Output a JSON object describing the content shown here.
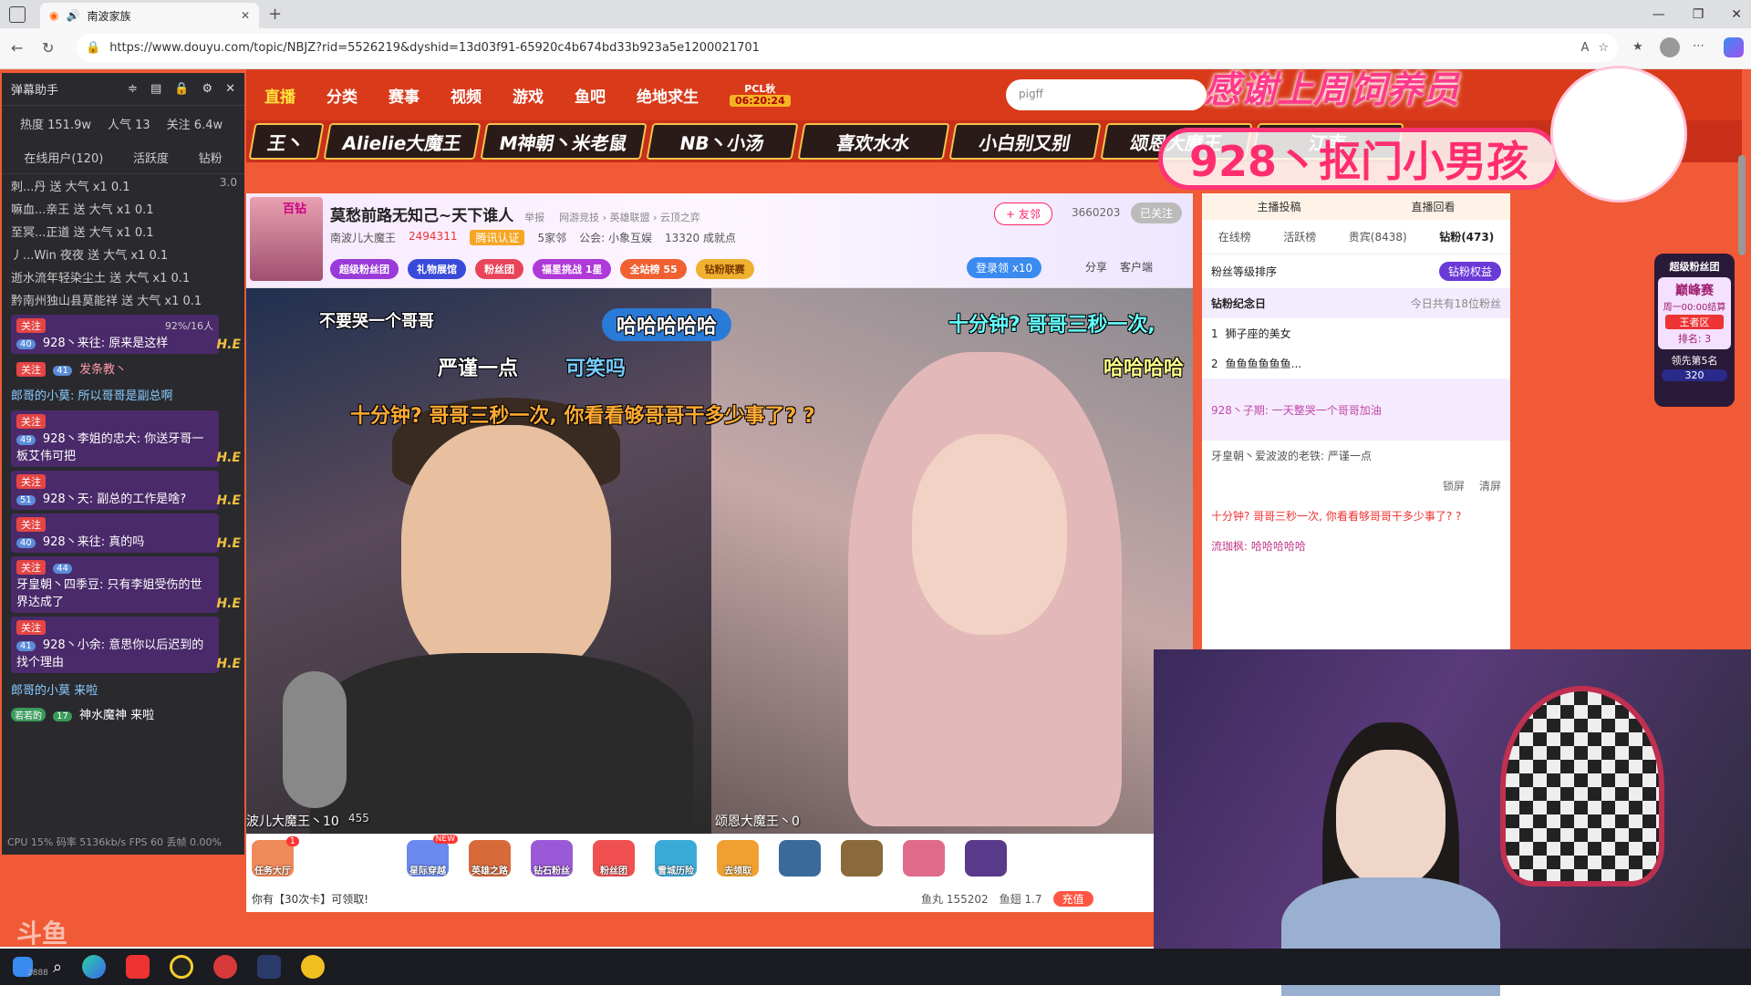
{
  "browser": {
    "tab_title": "南波家族",
    "url": "https://www.douyu.com/topic/NBJZ?rid=5526219&dyshid=13d03f91-65920c4b674bd33b923a5e1200021701",
    "window_controls": [
      "—",
      "❐",
      "✕"
    ]
  },
  "nav": {
    "items": [
      "直播",
      "分类",
      "赛事",
      "视频",
      "游戏",
      "鱼吧",
      "绝地求生"
    ],
    "pcl_label": "PCL秋",
    "pcl_time": "06:20:24",
    "search_placeholder": "pigff"
  },
  "hosts": [
    "王丶",
    "Alielie大魔王",
    "M神朝丶米老鼠",
    "NB丶小汤",
    "喜欢水水",
    "小白别又别",
    "颂恩大魔王",
    "江南"
  ],
  "banner": {
    "thanks": "感谢上周饲养员",
    "name": "928丶抠门小男孩"
  },
  "assistant": {
    "title": "弹幕助手",
    "stats": {
      "heat": "热度 151.9w",
      "popularity": "人气 13",
      "follow": "关注 6.4w"
    },
    "tabs": [
      "在线用户(120)",
      "活跃度",
      "钻粉"
    ],
    "gift_count_badge": "3.0",
    "gift_lines": [
      "刺...丹 送 大气 x1 0.1",
      "嘛血...亲王 送 大气 x1 0.1",
      "至冥...正道 送 大气 x1 0.1",
      "丿...Win 夜夜 送 大气 x1 0.1",
      "逝水流年轻染尘土 送 大气 x1 0.1",
      "黔南州独山县莫能祥 送 大气 x1 0.1"
    ],
    "chat": [
      {
        "follow": "关注",
        "lvl": "40",
        "text": "928丶来往: 原来是这样",
        "extra": "92%/16人"
      },
      {
        "follow": "关注",
        "lvl": "41",
        "text": "发条教丶",
        "extra": ""
      },
      {
        "follow": "",
        "lvl": "",
        "text": "郎哥的小莫: 所以哥哥是副总啊",
        "extra": ""
      },
      {
        "follow": "关注",
        "lvl": "49",
        "text": "928丶李姐的忠犬: 你送牙哥一板艾伟可把",
        "extra": ""
      },
      {
        "follow": "关注",
        "lvl": "51",
        "text": "928丶天: 副总的工作是啥?",
        "extra": ""
      },
      {
        "follow": "关注",
        "lvl": "40",
        "text": "928丶来往: 真的吗",
        "extra": ""
      },
      {
        "follow": "关注",
        "lvl": "44",
        "text": "牙皇朝丶四季豆: 只有李姐受伤的世界达成了",
        "extra": ""
      },
      {
        "follow": "关注",
        "lvl": "41",
        "text": "928丶小余: 意思你以后迟到的找个理由",
        "extra": ""
      }
    ],
    "he_label": "H.E",
    "line_come": "郎哥的小莫 来啦",
    "line_come2_tags": [
      "若若酌",
      "17"
    ],
    "line_come2_text": "神水魔神 来啦",
    "cpu": "CPU 15% 码率 5136kb/s FPS 60 丢帧 0.00%"
  },
  "room": {
    "title": "莫愁前路无知己~天下谁人",
    "report": "举报",
    "categories": "网游竞技 › 英雄联盟 › 云顶之弈",
    "owner": "南波儿大魔王",
    "fans": "2494311",
    "verify": "腾讯认证",
    "families": "5家邻",
    "guild": "公会: 小象互娱",
    "achievement": "13320 成就点",
    "badges": [
      "超级粉丝团",
      "礼物展馆",
      "粉丝团",
      "福星挑战 1星",
      "全站榜 55",
      "钻粉联赛"
    ],
    "follow_btn": "+ 友邻",
    "follow_count": "3660203",
    "followed": "已关注",
    "login_reward": "登录领 x10",
    "share": "分享",
    "client": "客户端",
    "bazi": "百钻"
  },
  "video": {
    "danmu": [
      "哈哈哈哈哈",
      "十分钟? 哥哥三秒一次,",
      "严谨一点",
      "可笑吗",
      "哈哈哈哈",
      "十分钟? 哥哥三秒一次, 你看看够哥哥干多少事了? ?",
      "不要哭一个哥哥"
    ],
    "cam_left": "波儿大魔王丶10",
    "cam_left_num": "455",
    "cam_right": "颂恩大魔王丶0"
  },
  "giftbar": {
    "items": [
      "任务大厅",
      "星际穿越",
      "英雄之路",
      "钻石粉丝",
      "粉丝团",
      "雪城历险",
      "去领取"
    ],
    "new_badge": "NEW",
    "task_badge": "1",
    "card_notice": "你有【30次卡】可领取!",
    "fish_ball": "鱼丸 155202",
    "fish_fin": "鱼翅 1.7",
    "recharge": "充值"
  },
  "rpanel": {
    "tabs": [
      "在线榜",
      "活跃榜",
      "贵宾(8438)",
      "钻粉(473)"
    ],
    "top_links": [
      "主播投稿",
      "直播回看"
    ],
    "sort_label": "粉丝等级排序",
    "rights": "钻粉权益",
    "memorial": "钻粉纪念日",
    "today": "今日共有18位粉丝",
    "rank": [
      {
        "n": "1",
        "name": "狮子座的美女"
      },
      {
        "n": "2",
        "name": "鱼鱼鱼鱼鱼鱼..."
      }
    ],
    "msgs": [
      "928丶子期: 一天整哭一个哥哥加油",
      "牙皇朝丶爱波波的老铁: 严谨一点",
      "十分钟? 哥哥三秒一次, 你看看够哥哥干多少事了? ?",
      "流珈枫: 哈哈哈哈哈"
    ],
    "lock": "锁屏",
    "clear": "清屏"
  },
  "superfan": {
    "title": "超级粉丝团",
    "peak": "巅峰赛",
    "week": "周一00:00结算",
    "zone": "王者区",
    "rank": "排名: 3",
    "lead": "领先第5名",
    "lead_val": "320"
  },
  "taskbar": {
    "clock": "2888"
  }
}
